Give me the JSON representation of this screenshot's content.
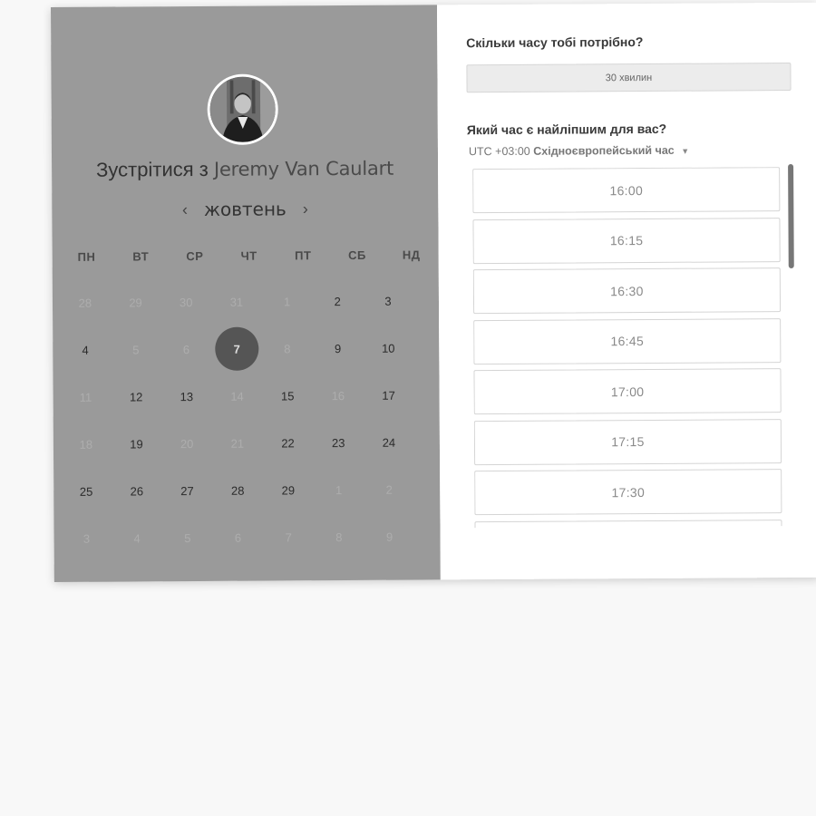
{
  "booking": {
    "meet_prefix": "Зустрітися з",
    "host_name": "Jeremy Van Caulart",
    "month": "жовтень",
    "prev_icon": "‹",
    "next_icon": "›",
    "weekdays": [
      "ПН",
      "ВТ",
      "СР",
      "ЧТ",
      "ПТ",
      "СБ",
      "НД"
    ],
    "weeks": [
      [
        {
          "d": "28",
          "s": "muted"
        },
        {
          "d": "29",
          "s": "muted"
        },
        {
          "d": "30",
          "s": "muted"
        },
        {
          "d": "31",
          "s": "muted"
        },
        {
          "d": "1",
          "s": "muted"
        },
        {
          "d": "2",
          "s": "avail"
        },
        {
          "d": "3",
          "s": "avail"
        }
      ],
      [
        {
          "d": "4",
          "s": "avail"
        },
        {
          "d": "5",
          "s": "muted"
        },
        {
          "d": "6",
          "s": "muted"
        },
        {
          "d": "7",
          "s": "selected"
        },
        {
          "d": "8",
          "s": "muted"
        },
        {
          "d": "9",
          "s": "avail"
        },
        {
          "d": "10",
          "s": "avail"
        }
      ],
      [
        {
          "d": "11",
          "s": "muted"
        },
        {
          "d": "12",
          "s": "avail"
        },
        {
          "d": "13",
          "s": "avail"
        },
        {
          "d": "14",
          "s": "muted"
        },
        {
          "d": "15",
          "s": "avail"
        },
        {
          "d": "16",
          "s": "muted"
        },
        {
          "d": "17",
          "s": "avail"
        }
      ],
      [
        {
          "d": "18",
          "s": "muted"
        },
        {
          "d": "19",
          "s": "avail"
        },
        {
          "d": "20",
          "s": "muted"
        },
        {
          "d": "21",
          "s": "muted"
        },
        {
          "d": "22",
          "s": "avail"
        },
        {
          "d": "23",
          "s": "avail"
        },
        {
          "d": "24",
          "s": "avail"
        }
      ],
      [
        {
          "d": "25",
          "s": "avail"
        },
        {
          "d": "26",
          "s": "avail"
        },
        {
          "d": "27",
          "s": "avail"
        },
        {
          "d": "28",
          "s": "avail"
        },
        {
          "d": "29",
          "s": "avail"
        },
        {
          "d": "1",
          "s": "muted"
        },
        {
          "d": "2",
          "s": "muted"
        }
      ],
      [
        {
          "d": "3",
          "s": "muted"
        },
        {
          "d": "4",
          "s": "muted"
        },
        {
          "d": "5",
          "s": "muted"
        },
        {
          "d": "6",
          "s": "muted"
        },
        {
          "d": "7",
          "s": "muted"
        },
        {
          "d": "8",
          "s": "muted"
        },
        {
          "d": "9",
          "s": "muted"
        }
      ]
    ]
  },
  "schedule": {
    "duration_question": "Скільки часу тобі потрібно?",
    "duration_value": "30 хвилин",
    "time_question": "Який час є найліпшим для вас?",
    "tz_offset": "UTC +03:00",
    "tz_name": "Східноєвропейський час",
    "tz_caret": "▼",
    "slots": [
      "16:00",
      "16:15",
      "16:30",
      "16:45",
      "17:00",
      "17:15",
      "17:30",
      ""
    ]
  },
  "colors": {
    "left_panel": "#9a9a9a",
    "selected_day": "#555555",
    "page_bg": "#f8f8f8"
  }
}
